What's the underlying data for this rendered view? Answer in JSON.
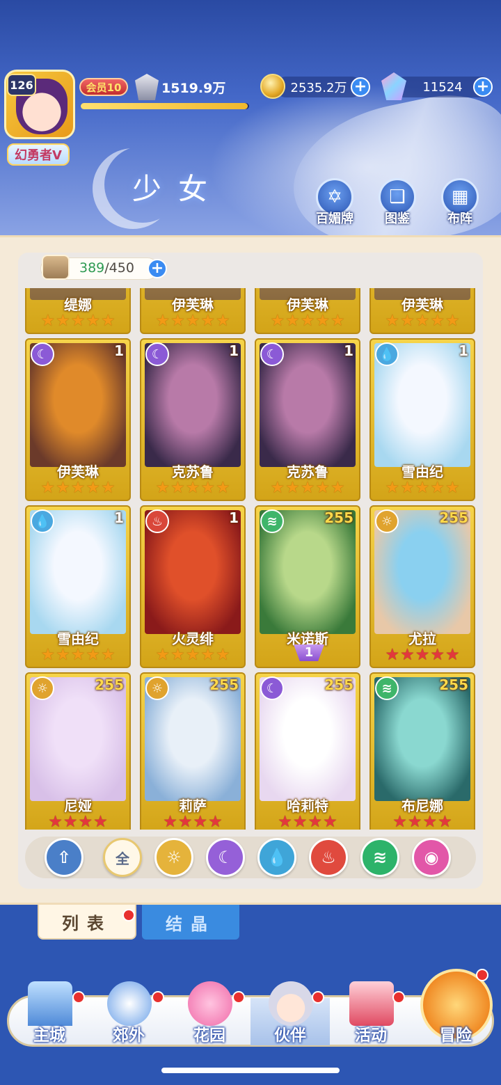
{
  "header": {
    "player_level": "126",
    "player_title": "幻勇者V",
    "vip": "会员10",
    "power": "1519.9万",
    "exp_progress": 0.99,
    "gold": "2535.2万",
    "gems": "11524",
    "page_title": "少女",
    "buttons": [
      {
        "label": "百媚牌",
        "icon": "card-deck-icon"
      },
      {
        "label": "图鉴",
        "icon": "book-icon"
      },
      {
        "label": "布阵",
        "icon": "grid-icon"
      }
    ]
  },
  "collection": {
    "current": "389",
    "max": "/450"
  },
  "cards_partial": [
    {
      "name": "缇娜",
      "stars": 5
    },
    {
      "name": "伊芙琳",
      "stars": 5
    },
    {
      "name": "伊芙琳",
      "stars": 5
    },
    {
      "name": "伊芙琳",
      "stars": 5
    }
  ],
  "cards": [
    {
      "name": "伊芙琳",
      "element": "moon",
      "level": "1",
      "stars": 5,
      "star_color": "gold",
      "art": [
        "#6b3a2a",
        "#e08a2a"
      ]
    },
    {
      "name": "克苏鲁",
      "element": "moon",
      "level": "1",
      "stars": 5,
      "star_color": "gold",
      "art": [
        "#3a2a4a",
        "#b87aa8"
      ]
    },
    {
      "name": "克苏鲁",
      "element": "moon",
      "level": "1",
      "stars": 5,
      "star_color": "gold",
      "art": [
        "#3a2a4a",
        "#b87aa8"
      ]
    },
    {
      "name": "雪由纪",
      "element": "water",
      "level": "1",
      "stars": 5,
      "star_color": "gold",
      "art": [
        "#a8d8f0",
        "#f4f8ff"
      ]
    },
    {
      "name": "雪由纪",
      "element": "water",
      "level": "1",
      "stars": 5,
      "star_color": "gold",
      "art": [
        "#a8d8f0",
        "#f4f8ff"
      ]
    },
    {
      "name": "火灵绯",
      "element": "fire",
      "level": "1",
      "stars": 5,
      "star_color": "gold",
      "art": [
        "#8a1a1a",
        "#e0502a"
      ]
    },
    {
      "name": "米诺斯",
      "element": "wind",
      "level": "255",
      "stars": 0,
      "star_color": "gold",
      "sub": "1",
      "art": [
        "#3a7a3a",
        "#b8d88a"
      ]
    },
    {
      "name": "尤拉",
      "element": "sun",
      "level": "255",
      "stars": 5,
      "star_color": "red",
      "art": [
        "#e8c8a8",
        "#8ad0f0"
      ]
    },
    {
      "name": "尼娅",
      "element": "sun",
      "level": "255",
      "stars": 4,
      "star_color": "red",
      "art": [
        "#d8c0e8",
        "#f0e0f8"
      ]
    },
    {
      "name": "莉萨",
      "element": "sun",
      "level": "255",
      "stars": 4,
      "star_color": "red",
      "art": [
        "#8ab0d8",
        "#e8f0f8"
      ]
    },
    {
      "name": "哈莉特",
      "element": "moon",
      "level": "255",
      "stars": 4,
      "star_color": "red",
      "art": [
        "#e8d8f0",
        "#ffffff"
      ]
    },
    {
      "name": "布尼娜",
      "element": "wind",
      "level": "255",
      "stars": 4,
      "star_color": "red",
      "art": [
        "#2a6a6a",
        "#8ad8d0"
      ]
    }
  ],
  "filters": [
    {
      "icon": "sort-up-icon",
      "label": ""
    },
    {
      "icon": "all-icon",
      "label": "全"
    },
    {
      "icon": "sun-element-icon",
      "label": ""
    },
    {
      "icon": "moon-element-icon",
      "label": ""
    },
    {
      "icon": "water-element-icon",
      "label": ""
    },
    {
      "icon": "fire-element-icon",
      "label": ""
    },
    {
      "icon": "wind-element-icon",
      "label": ""
    },
    {
      "icon": "star-element-icon",
      "label": ""
    }
  ],
  "tabs": {
    "list": "列表",
    "crystal": "结晶"
  },
  "nav": [
    {
      "label": "主城",
      "icon": "castle-icon"
    },
    {
      "label": "郊外",
      "icon": "hexagram-icon"
    },
    {
      "label": "花园",
      "icon": "heart-icon"
    },
    {
      "label": "伙伴",
      "icon": "partner-avatar-icon"
    },
    {
      "label": "活动",
      "icon": "gift-box-icon"
    },
    {
      "label": "冒险",
      "icon": "compass-icon"
    }
  ]
}
